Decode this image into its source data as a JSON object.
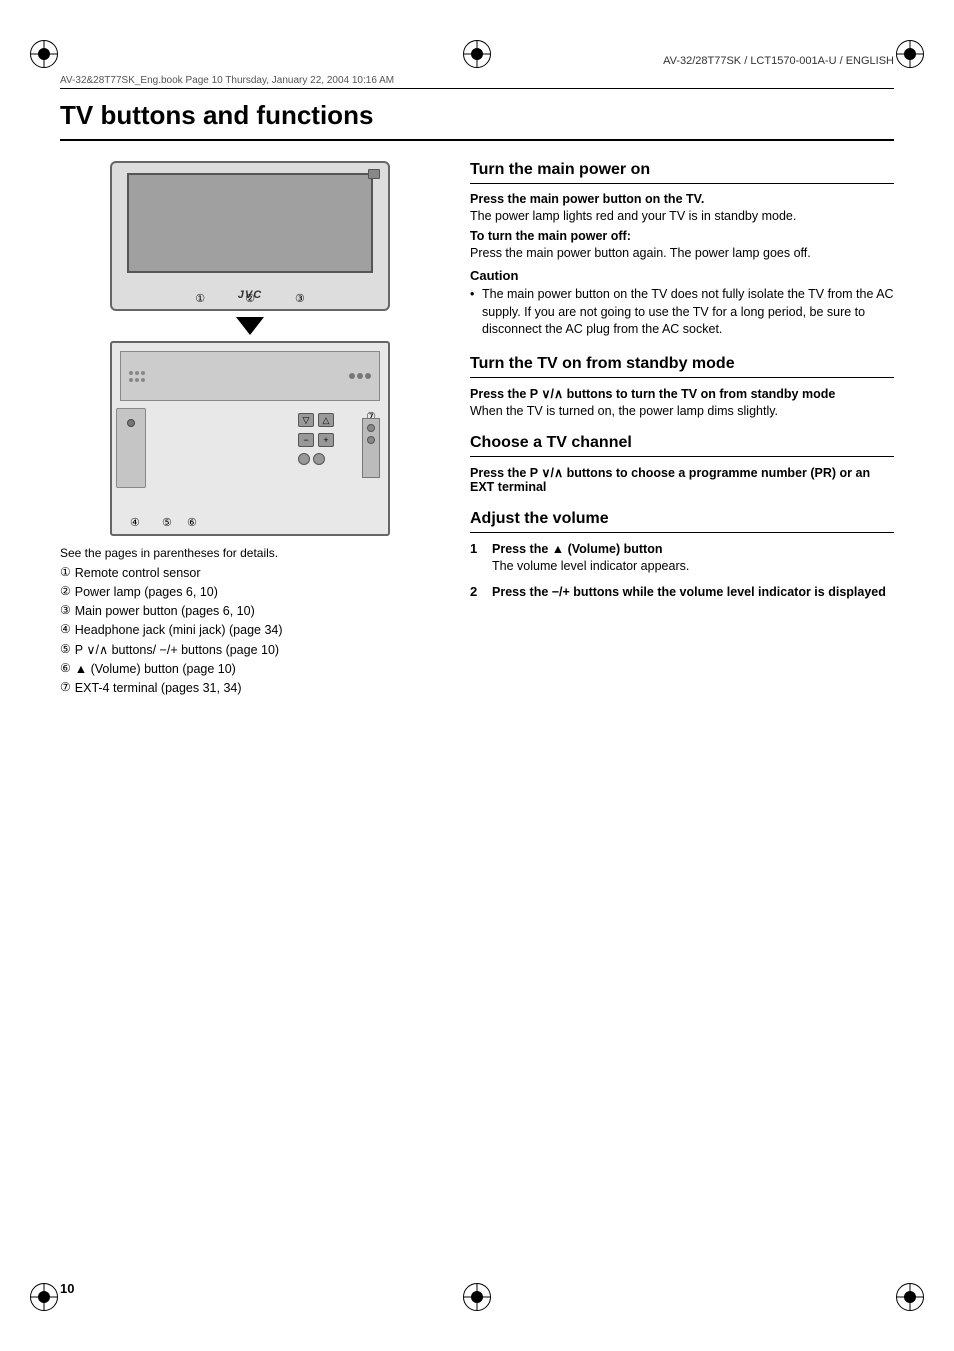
{
  "header": {
    "model": "AV-32/28T77SK / LCT1570-001A-U / ENGLISH",
    "file_info": "AV-32&28T77SK_Eng.book  Page 10  Thursday, January 22, 2004  10:16 AM"
  },
  "page": {
    "title": "TV buttons and functions",
    "number": "10"
  },
  "diagram": {
    "intro": "See the pages in parentheses for details.",
    "parts": [
      {
        "num": "①",
        "text": "Remote control sensor"
      },
      {
        "num": "②",
        "text": "Power lamp (pages 6, 10)"
      },
      {
        "num": "③",
        "text": "Main power button (pages 6, 10)"
      },
      {
        "num": "④",
        "text": "Headphone jack (mini jack) (page 34)"
      },
      {
        "num": "⑤",
        "text": "P ∨/∧ buttons/ −/+ buttons (page 10)"
      },
      {
        "num": "⑥",
        "text": "▲ (Volume) button (page 10)"
      },
      {
        "num": "⑦",
        "text": "EXT-4 terminal (pages 31, 34)"
      }
    ]
  },
  "sections": {
    "turn_main_power": {
      "heading": "Turn the main power on",
      "instruction1_bold": "Press the main power button on the TV.",
      "instruction1_text": "The power lamp lights red and your TV is in standby mode.",
      "instruction2_bold": "To turn the main power off:",
      "instruction2_text": "Press the main power button again. The power lamp goes off.",
      "caution_heading": "Caution",
      "caution_bullet": "The main power button on the TV does not fully isolate the TV from the AC supply. If you are not going to use the TV for a long period, be sure to disconnect the AC plug from the AC socket."
    },
    "turn_standby": {
      "heading": "Turn the TV on from standby mode",
      "instruction1_bold": "Press the P ∨/∧ buttons to turn the TV on from standby mode",
      "instruction1_text": "When the TV is turned on, the power lamp dims slightly."
    },
    "choose_channel": {
      "heading": "Choose a TV channel",
      "instruction1_bold": "Press the P ∨/∧ buttons to choose a programme number (PR) or an EXT terminal"
    },
    "adjust_volume": {
      "heading": "Adjust the volume",
      "step1_num": "1",
      "step1_bold": "Press the ▲ (Volume) button",
      "step1_text": "The volume level indicator appears.",
      "step2_num": "2",
      "step2_bold": "Press the −/+ buttons while the volume level indicator is displayed"
    }
  }
}
